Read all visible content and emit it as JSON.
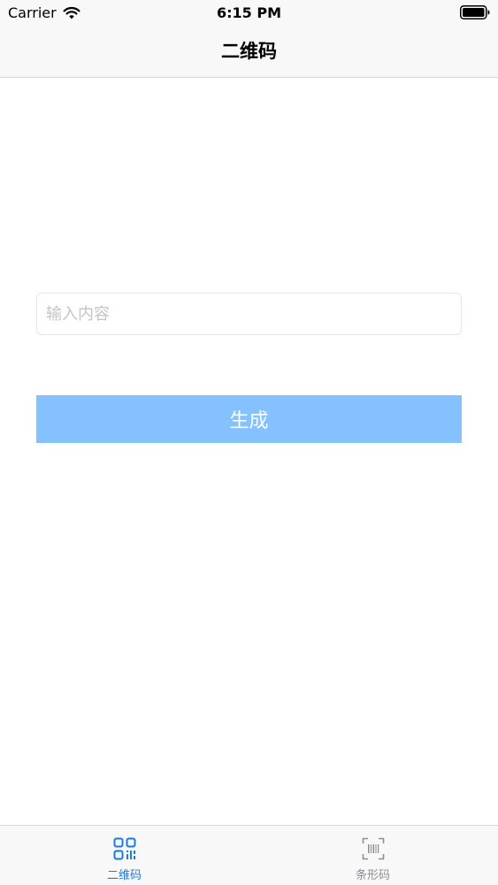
{
  "status_bar": {
    "carrier": "Carrier",
    "time": "6:15 PM"
  },
  "nav": {
    "title": "二维码"
  },
  "form": {
    "input_placeholder": "输入内容",
    "input_value": "",
    "generate_label": "生成"
  },
  "tabs": [
    {
      "label": "二维码",
      "icon": "qr-code-icon",
      "selected": true
    },
    {
      "label": "条形码",
      "icon": "barcode-icon",
      "selected": false
    }
  ],
  "colors": {
    "accent": "#1a7ae6",
    "button": "#84c1fe",
    "inactive": "#8e8e93"
  }
}
